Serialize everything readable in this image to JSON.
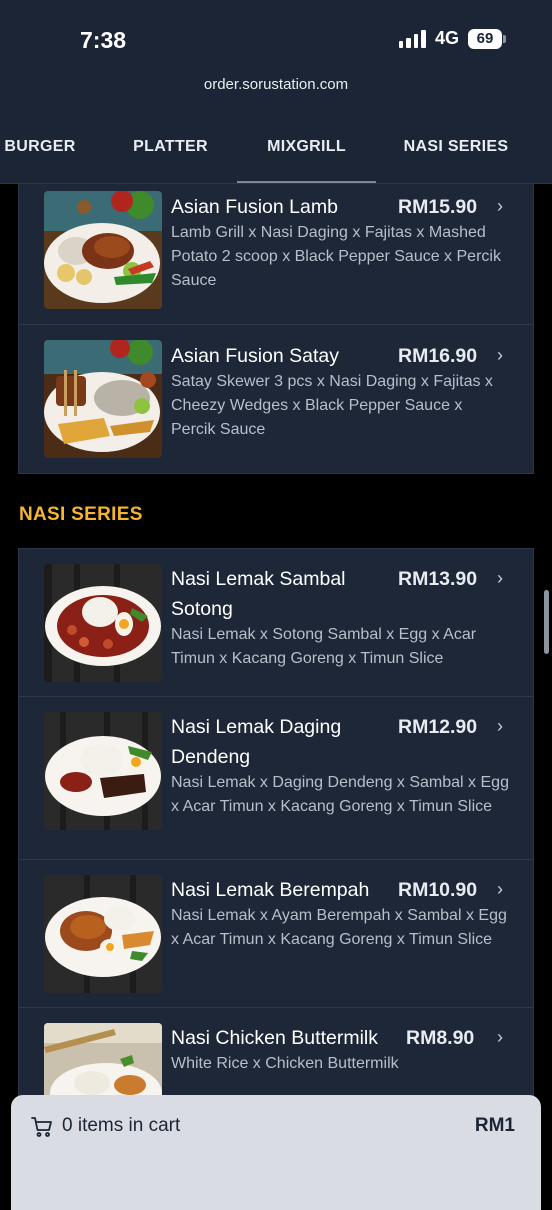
{
  "status": {
    "time": "7:38",
    "network": "4G",
    "battery": "69"
  },
  "browser": {
    "url": "order.sorustation.com"
  },
  "tabs": [
    {
      "label": "BURGER"
    },
    {
      "label": "PLATTER"
    },
    {
      "label": "MIXGRILL",
      "active": true
    },
    {
      "label": "NASI SERIES"
    }
  ],
  "mixgrill_items": [
    {
      "name": "Asian Fusion Lamb",
      "price": "RM15.90",
      "desc": "Lamb Grill x Nasi Daging x Fajitas x Mashed Potato 2 scoop x Black Pepper Sauce x Percik Sauce"
    },
    {
      "name": "Asian Fusion Satay",
      "price": "RM16.90",
      "desc": "Satay Skewer 3 pcs x Nasi Daging x Fajitas x Cheezy Wedges x Black Pepper Sauce x Percik Sauce"
    }
  ],
  "nasi_section": {
    "title": "NASI SERIES"
  },
  "nasi_items": [
    {
      "name": "Nasi Lemak Sambal Sotong",
      "price": "RM13.90",
      "desc": "Nasi Lemak x Sotong Sambal x Egg x Acar Timun x Kacang Goreng x Timun Slice"
    },
    {
      "name": "Nasi Lemak Daging Dendeng",
      "price": "RM12.90",
      "desc": "Nasi Lemak x Daging Dendeng x Sambal x Egg x Acar Timun x Kacang Goreng x Timun Slice"
    },
    {
      "name": "Nasi Lemak Berempah",
      "price": "RM10.90",
      "desc": "Nasi Lemak x Ayam Berempah x Sambal x Egg x Acar Timun x Kacang Goreng x Timun Slice"
    },
    {
      "name": "Nasi Chicken Buttermilk",
      "price": "RM8.90",
      "desc": "White Rice x Chicken Buttermilk"
    }
  ],
  "cart": {
    "items_text": "0 items in cart",
    "total": "RM1"
  },
  "colors": {
    "accent": "#f6b531",
    "header_bg": "#1b2535",
    "card_bg": "#1e2738",
    "cart_bg": "#d9dde3"
  },
  "icons": {
    "chevron": "chevron-right-icon",
    "cart": "cart-icon"
  }
}
